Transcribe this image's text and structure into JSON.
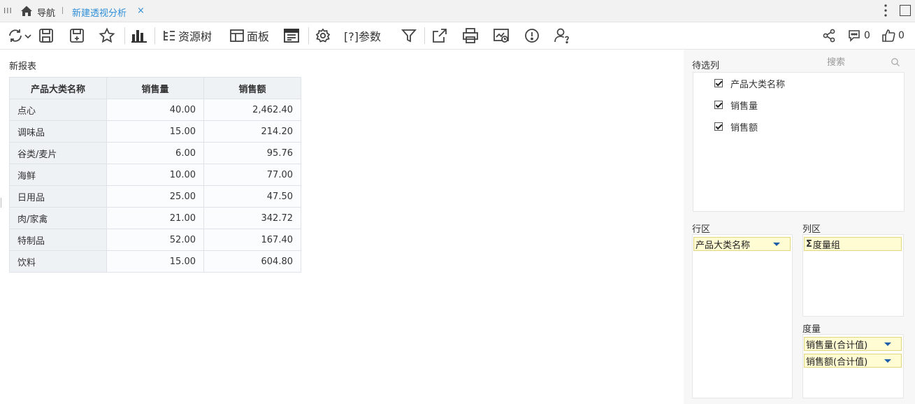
{
  "tabbar": {
    "nav_label": "导航",
    "active_tab": "新建透视分析",
    "close_glyph": "×",
    "icons": [
      "menu-grip-icon",
      "home-icon",
      "close-icon",
      "more-vertical-icon",
      "maximize-icon"
    ]
  },
  "toolbar": {
    "resource_tree_label": "资源树",
    "panel_label": "面板",
    "params_label": "[?]参数",
    "comment_count": "0",
    "like_count": "0",
    "icons": [
      "refresh-icon",
      "save-icon",
      "save-as-icon",
      "favorite-star-icon",
      "bar-chart-icon",
      "resource-tree-icon",
      "panel-icon",
      "report-view-icon",
      "settings-icon",
      "filter-icon",
      "export-icon",
      "print-icon",
      "schedule-icon",
      "alert-icon",
      "user-help-icon",
      "share-icon",
      "comment-icon",
      "like-icon"
    ]
  },
  "report": {
    "title": "新报表",
    "columns": [
      "产品大类名称",
      "销售量",
      "销售额"
    ],
    "rows": [
      [
        "点心",
        "40.00",
        "2,462.40"
      ],
      [
        "调味品",
        "15.00",
        "214.20"
      ],
      [
        "谷类/麦片",
        "6.00",
        "95.76"
      ],
      [
        "海鲜",
        "10.00",
        "77.00"
      ],
      [
        "日用品",
        "25.00",
        "47.50"
      ],
      [
        "肉/家禽",
        "21.00",
        "342.72"
      ],
      [
        "特制品",
        "52.00",
        "167.40"
      ],
      [
        "饮料",
        "15.00",
        "604.80"
      ]
    ]
  },
  "panel": {
    "candidates_label": "待选列",
    "search_placeholder": "搜索",
    "fields": [
      "产品大类名称",
      "销售量",
      "销售额"
    ],
    "row_area_label": "行区",
    "column_area_label": "列区",
    "measure_area_label": "度量",
    "row_items": [
      "产品大类名称"
    ],
    "column_items": [
      "度量组"
    ],
    "sigma_glyph": "Σ",
    "measure_items": [
      "销售量(合计值)",
      "销售额(合计值)"
    ]
  },
  "colors": {
    "accent": "#2f8fd8",
    "pill_bg": "#fffbd2",
    "pill_border": "#e7d77c",
    "caret": "#1d5ea8",
    "header_bg": "#eef2f5"
  }
}
